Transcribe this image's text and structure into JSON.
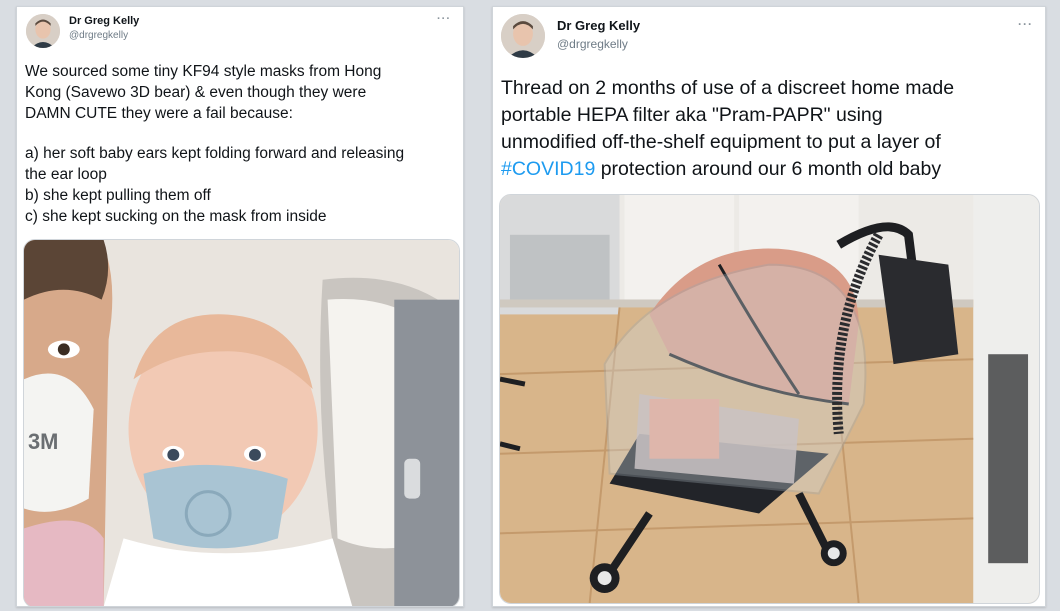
{
  "tweets": [
    {
      "author_name": "Dr Greg Kelly",
      "author_handle": "@drgregkelly",
      "more_label": "···",
      "text_lines": [
        "We sourced some tiny KF94 style masks from Hong",
        "Kong (Savewo 3D bear) & even though they were",
        "DAMN CUTE they were a fail because:"
      ],
      "list_lines": [
        "a) her soft baby ears kept folding forward and releasing",
        "the ear loop",
        "b) she kept pulling them off",
        "c) she kept sucking on the mask from inside"
      ],
      "image_icon": "photo-baby-mask"
    },
    {
      "author_name": "Dr Greg Kelly",
      "author_handle": "@drgregkelly",
      "more_label": "···",
      "text_lines": [
        "Thread on 2 months of use of a discreet home made",
        "portable HEPA filter aka \"Pram-PAPR\" using",
        "unmodified off-the-shelf equipment to put a layer of"
      ],
      "hashtag": "#COVID19",
      "text_after_hashtag": " protection around our 6 month old baby",
      "image_icon": "photo-pram"
    }
  ],
  "colors": {
    "hashtag": "#1d9bf0",
    "background": "#d9dde2",
    "text": "#101418",
    "handle": "#6e7b86"
  }
}
